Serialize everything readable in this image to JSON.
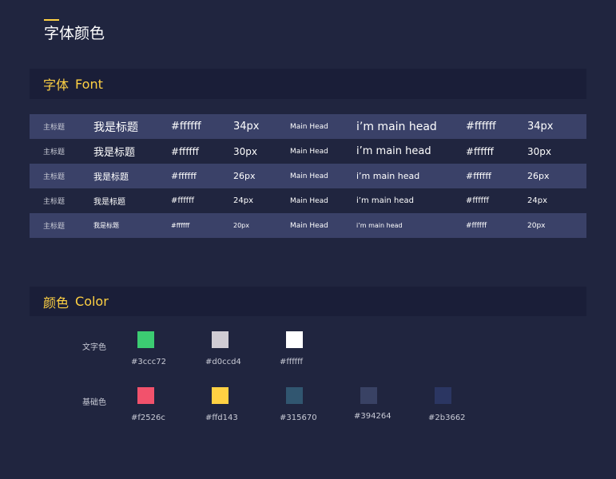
{
  "page": {
    "title": "字体颜色"
  },
  "font_section": {
    "title_cn": "字体",
    "title_en": "Font"
  },
  "font_rows": [
    {
      "label": "主标题",
      "cn_sample": "我是标题",
      "hex": "#ffffff",
      "size": "34px",
      "en_label": "Main Head",
      "en_sample": "i’m main head",
      "hex2": "#ffffff",
      "size2": "34px"
    },
    {
      "label": "主标题",
      "cn_sample": "我是标题",
      "hex": "#ffffff",
      "size": "30px",
      "en_label": "Main Head",
      "en_sample": "i’m main head",
      "hex2": "#ffffff",
      "size2": "30px"
    },
    {
      "label": "主标题",
      "cn_sample": "我是标题",
      "hex": "#ffffff",
      "size": "26px",
      "en_label": "Main Head",
      "en_sample": "i’m main head",
      "hex2": "#ffffff",
      "size2": "26px"
    },
    {
      "label": "主标题",
      "cn_sample": "我是标题",
      "hex": "#ffffff",
      "size": "24px",
      "en_label": "Main Head",
      "en_sample": "i’m main head",
      "hex2": "#ffffff",
      "size2": "24px"
    },
    {
      "label": "主标题",
      "cn_sample": "我是标题",
      "hex": "#ffffff",
      "size": "20px",
      "en_label": "Main Head",
      "en_sample": "i’m main head",
      "hex2": "#ffffff",
      "size2": "20px"
    }
  ],
  "color_section": {
    "title_cn": "颜色",
    "title_en": "Color",
    "text_colors": {
      "label": "文字色",
      "swatches": [
        {
          "hex": "#3ccc72",
          "label": "#3ccc72"
        },
        {
          "hex": "#d0ccd4",
          "label": "#d0ccd4"
        },
        {
          "hex": "#ffffff",
          "label": "#ffffff"
        }
      ]
    },
    "base_colors": {
      "label": "基础色",
      "swatches": [
        {
          "hex": "#f2526c",
          "label": "#f2526c"
        },
        {
          "hex": "#ffd143",
          "label": "#ffd143"
        },
        {
          "hex": "#315670",
          "label": "#315670"
        },
        {
          "hex": "#394264",
          "label": "#394264"
        },
        {
          "hex": "#2b3662",
          "label": "#2b3662"
        }
      ]
    }
  }
}
